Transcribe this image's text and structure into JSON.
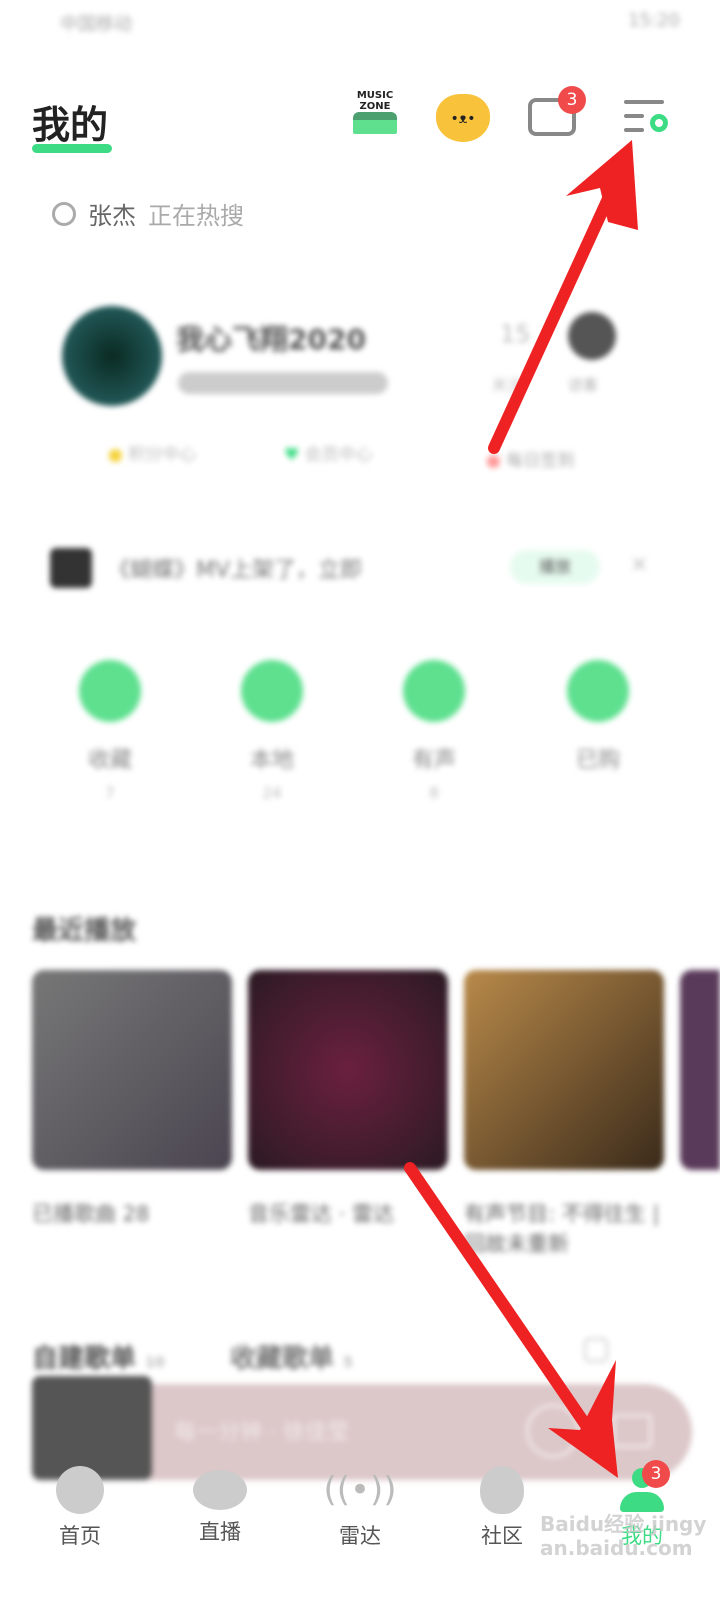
{
  "status_bar": {
    "carrier": "中国移动",
    "time": "15:20"
  },
  "header": {
    "title": "我的",
    "icons": [
      "music-zone-icon",
      "cat-avatar-icon",
      "mail-icon",
      "settings-menu-icon"
    ],
    "music_zone_text": "MUSIC ZONE",
    "mail_badge": "3"
  },
  "search": {
    "keyword": "张杰",
    "hint": "正在热搜"
  },
  "profile": {
    "name": "我心飞翔2020",
    "follow_count": "15",
    "follow_label": "关注",
    "visitor_label": "访客",
    "links": [
      "积分中心",
      "会员中心",
      "每日签到"
    ]
  },
  "banner": {
    "text": "《蝴蝶》MV上架了，立即",
    "button": "播放"
  },
  "quick": [
    {
      "label": "收藏",
      "count": "7"
    },
    {
      "label": "本地",
      "count": "24"
    },
    {
      "label": "有声",
      "count": "8"
    },
    {
      "label": "已购",
      "count": ""
    }
  ],
  "recent": {
    "title": "最近播放",
    "items": [
      "已播歌曲 28",
      "音乐雷达 · 雷达",
      "有声节目: 不得往生 | 回故未重新"
    ]
  },
  "playlists": {
    "tab1": "自建歌单",
    "count1": "10",
    "tab2": "收藏歌单",
    "count2": "5"
  },
  "player": {
    "text": "每一分钟 · 徐佳莹"
  },
  "nav": [
    {
      "label": "首页",
      "icon": "music-note-icon"
    },
    {
      "label": "直播",
      "icon": "eye-icon"
    },
    {
      "label": "雷达",
      "icon": "radar-icon"
    },
    {
      "label": "社区",
      "icon": "community-icon"
    },
    {
      "label": "我的",
      "icon": "person-icon",
      "badge": "3"
    }
  ],
  "colors": {
    "accent": "#3ddc84",
    "badge": "#f04a4a",
    "annotation_arrow": "#ee2222"
  },
  "watermark": "Baidu经验 jingyan.baidu.com"
}
